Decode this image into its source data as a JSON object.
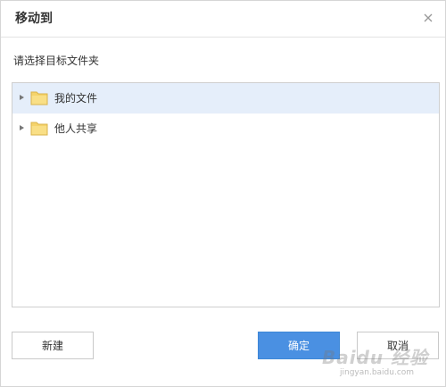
{
  "dialog": {
    "title": "移动到",
    "subtitle": "请选择目标文件夹"
  },
  "tree": {
    "items": [
      {
        "label": "我的文件",
        "selected": true,
        "icon": "folder-icon"
      },
      {
        "label": "他人共享",
        "selected": false,
        "icon": "folder-icon"
      }
    ]
  },
  "buttons": {
    "new_label": "新建",
    "ok_label": "确定",
    "cancel_label": "取消"
  },
  "watermark": {
    "main": "Baidu 经验",
    "sub": "jingyan.baidu.com"
  },
  "colors": {
    "primary": "#4a90e2",
    "selected_row": "#e5eefa",
    "folder": "#f5d36b"
  }
}
